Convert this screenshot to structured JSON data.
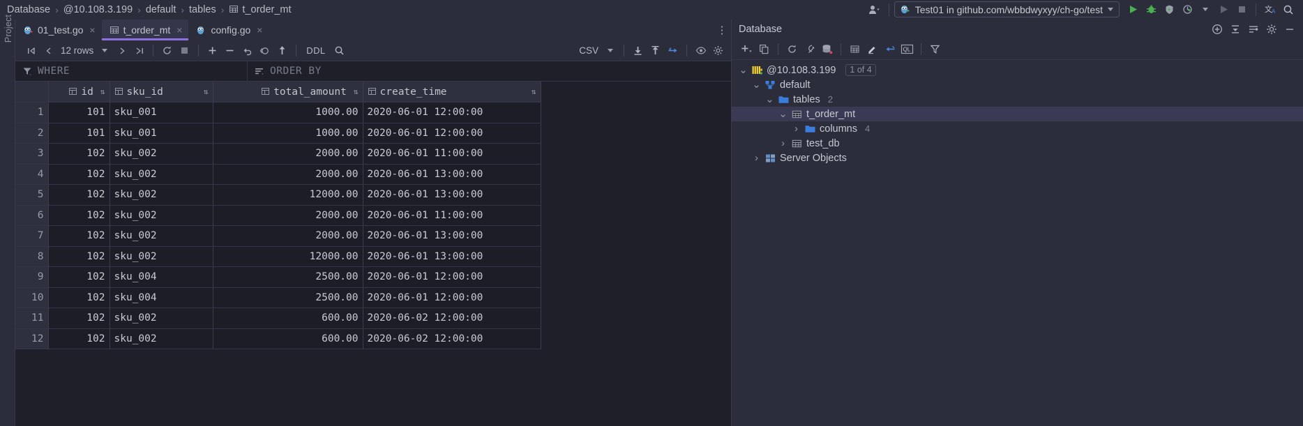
{
  "breadcrumb": {
    "items": [
      {
        "label": "Database",
        "icon": ""
      },
      {
        "label": "@10.108.3.199",
        "icon": ""
      },
      {
        "label": "default",
        "icon": ""
      },
      {
        "label": "tables",
        "icon": ""
      },
      {
        "label": "t_order_mt",
        "icon": "table-icon"
      }
    ],
    "separator": "›"
  },
  "topbar": {
    "user_icon": "user-icon",
    "run_config": {
      "icon": "go-gopher-icon",
      "label": "Test01 in github.com/wbbdwyxyy/ch-go/test",
      "dropdown_icon": "chevron-down-icon"
    },
    "actions": [
      {
        "name": "run-button",
        "icon": "run-icon"
      },
      {
        "name": "debug-button",
        "icon": "debug-icon"
      },
      {
        "name": "run-with-coverage-button",
        "icon": "coverage-icon"
      },
      {
        "name": "profiler-button",
        "icon": "profiler-icon"
      },
      {
        "name": "profiler-dropdown",
        "icon": "chevron-down-icon"
      },
      {
        "name": "run-disabled-button",
        "icon": "run-disabled-icon"
      },
      {
        "name": "stop-button",
        "icon": "stop-icon"
      },
      {
        "name": "translate-button",
        "icon": "translate-icon"
      },
      {
        "name": "search-everywhere-button",
        "icon": "search-icon"
      }
    ]
  },
  "left_rail": {
    "label": "Project"
  },
  "tabs": [
    {
      "label": "01_test.go",
      "icon": "go-file-icon",
      "active": false,
      "close": "×"
    },
    {
      "label": "t_order_mt",
      "icon": "table-icon",
      "active": true,
      "close": "×"
    },
    {
      "label": "config.go",
      "icon": "go-file-icon",
      "active": false,
      "close": "×"
    }
  ],
  "tab_overflow_icon": "kebab-menu-icon",
  "grid_toolbar": {
    "first_page_icon": "first-page-icon",
    "prev_page_icon": "prev-page-icon",
    "rows_label": "12 rows",
    "rows_dropdown_icon": "chevron-down-icon",
    "next_page_icon": "next-page-icon",
    "last_page_icon": "last-page-icon",
    "reload_icon": "refresh-icon",
    "stop_icon": "stop-square-icon",
    "add_row_icon": "plus-icon",
    "delete_row_icon": "minus-icon",
    "revert_icon": "undo-icon",
    "find_revert_icon": "revert-selected-icon",
    "submit_icon": "upload-arrow-icon",
    "ddl_label": "DDL",
    "search_icon": "search-icon",
    "export_format": "CSV",
    "export_format_dropdown_icon": "chevron-down-icon",
    "download_icon": "download-icon",
    "import_icon": "import-icon",
    "export_to_db_icon": "export-to-database-icon",
    "view_icon": "eye-icon",
    "settings_icon": "gear-icon"
  },
  "filters": {
    "where": {
      "icon": "filter-icon",
      "label": "WHERE"
    },
    "order_by": {
      "icon": "sort-icon",
      "label": "ORDER BY"
    }
  },
  "grid": {
    "columns": [
      {
        "key": "rownum",
        "label": "",
        "icon": "",
        "sortable": false
      },
      {
        "key": "id",
        "label": "id",
        "icon": "column-icon",
        "sortable": true
      },
      {
        "key": "sku_id",
        "label": "sku_id",
        "icon": "column-icon",
        "sortable": true
      },
      {
        "key": "total_amount",
        "label": "total_amount",
        "icon": "column-icon",
        "sortable": true
      },
      {
        "key": "create_time",
        "label": "create_time",
        "icon": "column-icon",
        "sortable": true
      }
    ],
    "sort_glyph": "⇅",
    "rows": [
      {
        "n": "1",
        "id": "101",
        "sku_id": "sku_001",
        "total_amount": "1000.00",
        "create_time": "2020-06-01 12:00:00"
      },
      {
        "n": "2",
        "id": "101",
        "sku_id": "sku_001",
        "total_amount": "1000.00",
        "create_time": "2020-06-01 12:00:00"
      },
      {
        "n": "3",
        "id": "102",
        "sku_id": "sku_002",
        "total_amount": "2000.00",
        "create_time": "2020-06-01 11:00:00"
      },
      {
        "n": "4",
        "id": "102",
        "sku_id": "sku_002",
        "total_amount": "2000.00",
        "create_time": "2020-06-01 13:00:00"
      },
      {
        "n": "5",
        "id": "102",
        "sku_id": "sku_002",
        "total_amount": "12000.00",
        "create_time": "2020-06-01 13:00:00"
      },
      {
        "n": "6",
        "id": "102",
        "sku_id": "sku_002",
        "total_amount": "2000.00",
        "create_time": "2020-06-01 11:00:00"
      },
      {
        "n": "7",
        "id": "102",
        "sku_id": "sku_002",
        "total_amount": "2000.00",
        "create_time": "2020-06-01 13:00:00"
      },
      {
        "n": "8",
        "id": "102",
        "sku_id": "sku_002",
        "total_amount": "12000.00",
        "create_time": "2020-06-01 13:00:00"
      },
      {
        "n": "9",
        "id": "102",
        "sku_id": "sku_004",
        "total_amount": "2500.00",
        "create_time": "2020-06-01 12:00:00"
      },
      {
        "n": "10",
        "id": "102",
        "sku_id": "sku_004",
        "total_amount": "2500.00",
        "create_time": "2020-06-01 12:00:00"
      },
      {
        "n": "11",
        "id": "102",
        "sku_id": "sku_002",
        "total_amount": "600.00",
        "create_time": "2020-06-02 12:00:00"
      },
      {
        "n": "12",
        "id": "102",
        "sku_id": "sku_002",
        "total_amount": "600.00",
        "create_time": "2020-06-02 12:00:00"
      }
    ]
  },
  "database_panel": {
    "title": "Database",
    "header_buttons": [
      {
        "name": "new-connection-button",
        "icon": "plus-circle-icon"
      },
      {
        "name": "collapse-all-button",
        "icon": "collapse-all-icon"
      },
      {
        "name": "filter-schemas-button",
        "icon": "schema-filter-icon"
      },
      {
        "name": "settings-button",
        "icon": "gear-icon"
      },
      {
        "name": "hide-panel-button",
        "icon": "minimize-icon"
      }
    ],
    "toolbar": [
      {
        "name": "new-button",
        "icon": "plus-dropdown-icon"
      },
      {
        "name": "duplicate-button",
        "icon": "copy-icon"
      },
      {
        "name": "refresh-button",
        "icon": "refresh-icon"
      },
      {
        "name": "jump-to-query-console-button",
        "icon": "query-console-icon"
      },
      {
        "name": "data-sources-button",
        "icon": "data-source-icon"
      },
      {
        "name": "table-editor-button",
        "icon": "table-icon"
      },
      {
        "name": "modify-button",
        "icon": "pencil-icon"
      },
      {
        "name": "jump-to-editor-button",
        "icon": "jump-to-icon"
      },
      {
        "name": "ql-console-button",
        "icon": "ql-icon"
      },
      {
        "name": "filter-button",
        "icon": "filter-icon"
      }
    ],
    "tree": [
      {
        "depth": 0,
        "twist": "⌄",
        "icon": "clickhouse-icon",
        "label": "@10.108.3.199",
        "count": "",
        "badge": "1 of 4",
        "selected": false
      },
      {
        "depth": 1,
        "twist": "⌄",
        "icon": "schema-icon",
        "label": "default",
        "count": "",
        "badge": "",
        "selected": false
      },
      {
        "depth": 2,
        "twist": "⌄",
        "icon": "folder-icon",
        "label": "tables",
        "count": "2",
        "badge": "",
        "selected": false
      },
      {
        "depth": 3,
        "twist": "⌄",
        "icon": "table-icon",
        "label": "t_order_mt",
        "count": "",
        "badge": "",
        "selected": true
      },
      {
        "depth": 4,
        "twist": "›",
        "icon": "folder-icon",
        "label": "columns",
        "count": "4",
        "badge": "",
        "selected": false
      },
      {
        "depth": 3,
        "twist": "›",
        "icon": "table-icon",
        "label": "test_db",
        "count": "",
        "badge": "",
        "selected": false
      },
      {
        "depth": 1,
        "twist": "›",
        "icon": "server-objects-icon",
        "label": "Server Objects",
        "count": "",
        "badge": "",
        "selected": false
      }
    ]
  },
  "colors": {
    "accent_purple": "#8d6fe0",
    "accent_green": "#59a869",
    "accent_blue": "#3b7ddd",
    "panel_bg": "#2b2d3a",
    "grid_bg": "#1c1d26",
    "selection": "#3b3a55"
  }
}
